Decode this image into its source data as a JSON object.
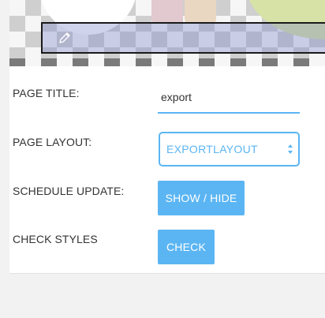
{
  "form": {
    "page_title_label": "PAGE TITLE:",
    "page_title_value": "export",
    "page_layout_label": "PAGE LAYOUT:",
    "page_layout_value": "EXPORTLAYOUT",
    "schedule_update_label": "SCHEDULE UPDATE:",
    "show_hide_label": "SHOW / HIDE",
    "check_styles_label": "CHECK STYLES",
    "check_label": "CHECK"
  },
  "icons": {
    "edit": "pencil-icon",
    "select": "sort-arrows-icon"
  },
  "colors": {
    "accent": "#5bb5f3",
    "text": "#333333"
  }
}
